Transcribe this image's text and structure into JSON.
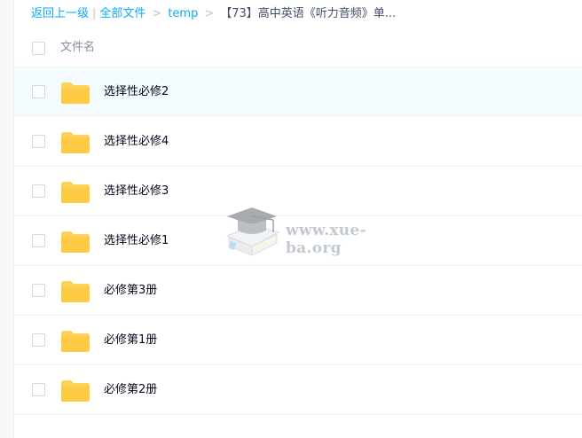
{
  "breadcrumb": {
    "back": "返回上一级",
    "separator": "|",
    "all_files": "全部文件",
    "arrow": ">",
    "folder": "temp",
    "current": "【73】高中英语《听力音频》单..."
  },
  "list_header": {
    "name_column": "文件名"
  },
  "files": [
    {
      "name": "选择性必修2",
      "icon": "folder-icon"
    },
    {
      "name": "选择性必修4",
      "icon": "folder-icon"
    },
    {
      "name": "选择性必修3",
      "icon": "folder-icon"
    },
    {
      "name": "选择性必修1",
      "icon": "folder-icon"
    },
    {
      "name": "必修第3册",
      "icon": "folder-icon"
    },
    {
      "name": "必修第1册",
      "icon": "folder-icon"
    },
    {
      "name": "必修第2册",
      "icon": "folder-icon"
    }
  ],
  "watermark": {
    "text": "www.xue-ba.org"
  },
  "colors": {
    "link": "#09aaff",
    "folder": "#ffd257",
    "hover_row": "#f4fbff"
  }
}
